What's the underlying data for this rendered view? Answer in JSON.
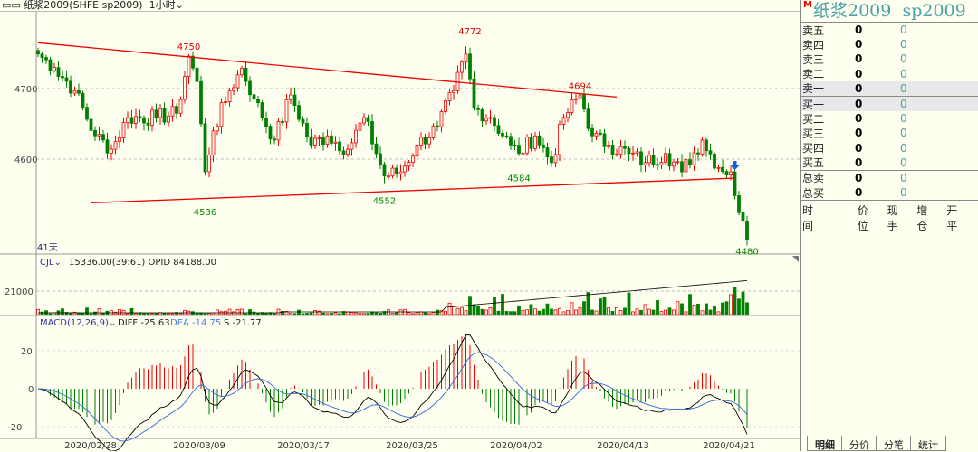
{
  "header": {
    "title": "▭▭ 纸浆2009(SHFE  sp2009)",
    "period": "1小时",
    "period_caret": "⌄"
  },
  "main": {
    "bar_count_label": "41天",
    "price_ticks": [
      4700,
      4600
    ],
    "annotations": [
      {
        "text": "4750",
        "price": 4750,
        "i": 37,
        "above": true
      },
      {
        "text": "4772",
        "price": 4772,
        "i": 106,
        "above": true
      },
      {
        "text": "4694",
        "price": 4694,
        "i": 133,
        "above": true
      },
      {
        "text": "4536",
        "price": 4536,
        "i": 41,
        "above": false
      },
      {
        "text": "4552",
        "price": 4552,
        "i": 85,
        "above": false
      },
      {
        "text": "4584",
        "price": 4584,
        "i": 118,
        "above": false
      },
      {
        "text": "4480",
        "price": 4480,
        "i": 174,
        "above": false
      }
    ],
    "trendlines": [
      {
        "from": [
          0,
          4765
        ],
        "to": [
          142,
          4688
        ],
        "color": "#ee0000"
      },
      {
        "from": [
          13,
          4538
        ],
        "to": [
          171,
          4573
        ],
        "color": "#ee0000"
      }
    ]
  },
  "volume": {
    "indicator": "CJL",
    "stats": "15336.00(39:61)  OPID 84188.00",
    "tick": "21000"
  },
  "macd": {
    "label": "MACD(12,26,9)",
    "diff": "DIFF -25.63",
    "dea": "DEA -14.75",
    "s": "S -21.77",
    "ticks": [
      "20",
      "0",
      "-20"
    ]
  },
  "chart_data": {
    "type": "candlestick",
    "bars": 175,
    "key_closes": [
      [
        0,
        4749
      ],
      [
        4,
        4730
      ],
      [
        9,
        4697
      ],
      [
        14,
        4633
      ],
      [
        18,
        4614
      ],
      [
        22,
        4659
      ],
      [
        29,
        4659
      ],
      [
        34,
        4665
      ],
      [
        37,
        4746
      ],
      [
        39,
        4710
      ],
      [
        41,
        4582
      ],
      [
        43,
        4640
      ],
      [
        47,
        4697
      ],
      [
        50,
        4729
      ],
      [
        53,
        4685
      ],
      [
        58,
        4627
      ],
      [
        62,
        4691
      ],
      [
        67,
        4620
      ],
      [
        71,
        4633
      ],
      [
        76,
        4614
      ],
      [
        80,
        4659
      ],
      [
        85,
        4576
      ],
      [
        89,
        4582
      ],
      [
        93,
        4620
      ],
      [
        98,
        4646
      ],
      [
        102,
        4697
      ],
      [
        105,
        4749
      ],
      [
        107,
        4672
      ],
      [
        111,
        4659
      ],
      [
        116,
        4620
      ],
      [
        118,
        4608
      ],
      [
        122,
        4633
      ],
      [
        126,
        4595
      ],
      [
        129,
        4659
      ],
      [
        133,
        4691
      ],
      [
        136,
        4633
      ],
      [
        140,
        4620
      ],
      [
        145,
        4608
      ],
      [
        149,
        4595
      ],
      [
        154,
        4608
      ],
      [
        158,
        4582
      ],
      [
        163,
        4627
      ],
      [
        167,
        4588
      ],
      [
        170,
        4582
      ],
      [
        172,
        4524
      ],
      [
        174,
        4486
      ]
    ],
    "dates": [
      "2020/02/28",
      "2020/03/09",
      "2020/03/17",
      "2020/03/25",
      "2020/04/02",
      "2020/04/13",
      "2020/04/21"
    ],
    "colors": {
      "up": "#ee0000",
      "down": "#008000"
    }
  },
  "panel": {
    "name": "纸浆2009",
    "code": "sp2009",
    "badge": "M",
    "asks": [
      {
        "l": "卖五",
        "p": "0",
        "v": "0"
      },
      {
        "l": "卖四",
        "p": "0",
        "v": "0"
      },
      {
        "l": "卖三",
        "p": "0",
        "v": "0"
      },
      {
        "l": "卖二",
        "p": "0",
        "v": "0"
      },
      {
        "l": "卖一",
        "p": "0",
        "v": "0"
      }
    ],
    "bids": [
      {
        "l": "买一",
        "p": "0",
        "v": "0"
      },
      {
        "l": "买二",
        "p": "0",
        "v": "0"
      },
      {
        "l": "买三",
        "p": "0",
        "v": "0"
      },
      {
        "l": "买四",
        "p": "0",
        "v": "0"
      },
      {
        "l": "买五",
        "p": "0",
        "v": "0"
      }
    ],
    "totals": [
      {
        "l": "总卖",
        "p": "0",
        "v": "0"
      },
      {
        "l": "总买",
        "p": "0",
        "v": "0"
      }
    ],
    "cols": [
      "时间",
      "价位",
      "现手",
      "增仓",
      "开平"
    ],
    "tabs": [
      "明细",
      "分价",
      "分笔",
      "统计"
    ]
  }
}
